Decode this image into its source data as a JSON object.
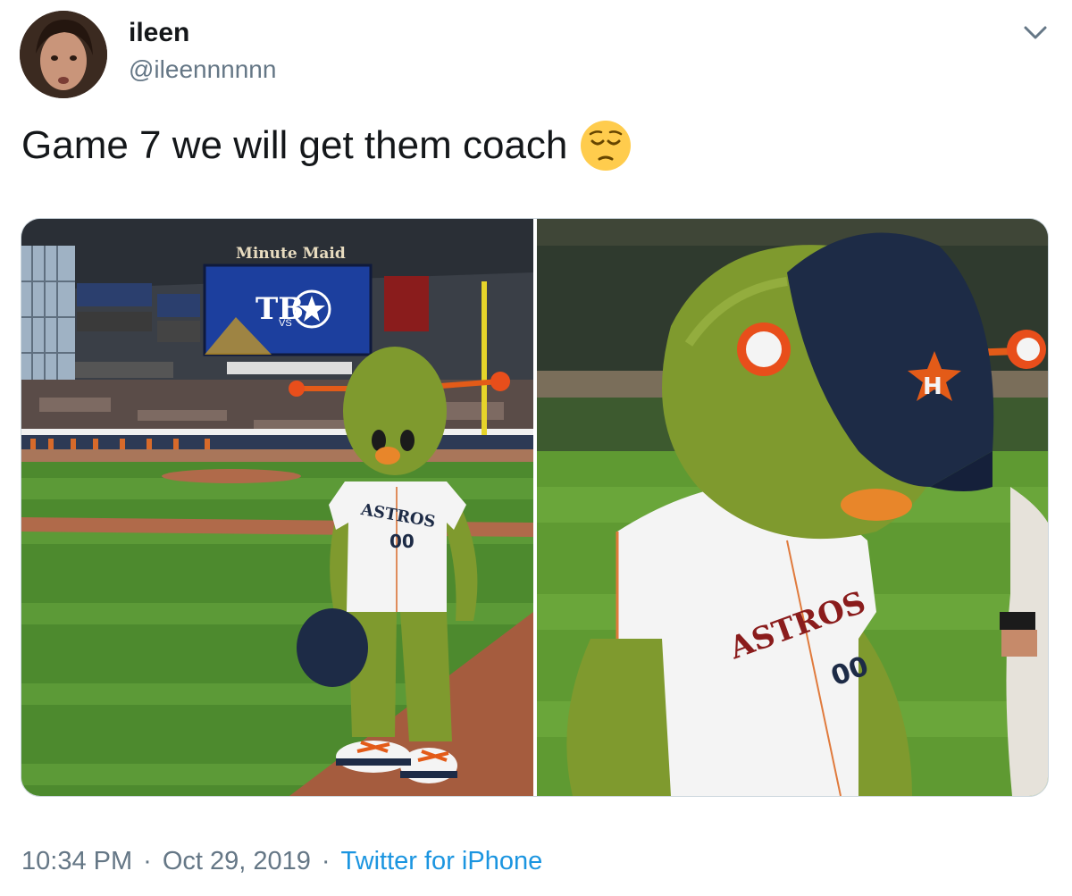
{
  "author": {
    "display_name": "ileen",
    "handle": "@ileennnnnn",
    "avatar_icon": "profile-photo"
  },
  "tweet": {
    "text": "Game 7 we will get them coach",
    "emoji_icon": "pensive-face-emoji"
  },
  "media": {
    "left_photo": {
      "stadium_sign": "Minute Maid",
      "scoreboard_left": "TB",
      "scoreboard_vs": "VS",
      "jersey_text": "ASTROS",
      "jersey_number": "00"
    },
    "right_photo": {
      "jersey_text": "ASTROS",
      "jersey_number": "00"
    }
  },
  "meta": {
    "time": "10:34 PM",
    "date": "Oct 29, 2019",
    "separator": "·",
    "source": "Twitter for iPhone"
  },
  "colors": {
    "text_primary": "#14171a",
    "text_secondary": "#657786",
    "link": "#1b95e0",
    "mascot_green": "#7f9a2e",
    "astros_orange": "#eb6e1f",
    "astros_navy": "#1d2b46"
  }
}
